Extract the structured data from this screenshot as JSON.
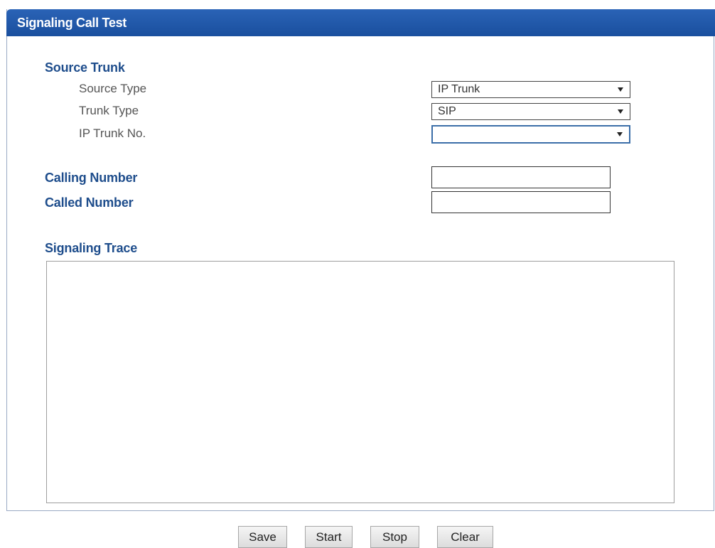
{
  "panel": {
    "title": "Signaling Call Test"
  },
  "source_trunk": {
    "heading": "Source Trunk",
    "source_type": {
      "label": "Source Type",
      "value": "IP Trunk"
    },
    "trunk_type": {
      "label": "Trunk Type",
      "value": "SIP"
    },
    "ip_trunk_no": {
      "label": "IP Trunk No.",
      "value": ""
    }
  },
  "calling_number": {
    "label": "Calling Number",
    "value": ""
  },
  "called_number": {
    "label": "Called Number",
    "value": ""
  },
  "signaling_trace": {
    "label": "Signaling Trace",
    "content": ""
  },
  "buttons": {
    "save": "Save",
    "start": "Start",
    "stop": "Stop",
    "clear": "Clear"
  },
  "icons": {
    "dropdown": "chevron-down-icon"
  },
  "colors": {
    "header": "#1a4f9e",
    "section_label": "#1e4d8c",
    "field_label": "#555555"
  }
}
